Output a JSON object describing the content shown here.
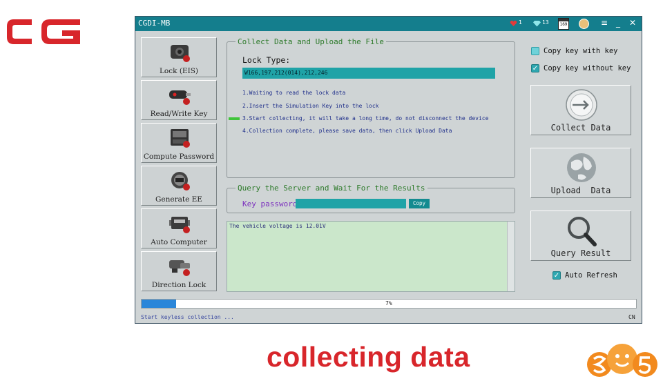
{
  "brand": {
    "caption": "collecting data"
  },
  "window": {
    "title": "CGDI-MB",
    "indicators": {
      "badge_1": "1",
      "badge_2": "13",
      "date": "169"
    },
    "controls": {
      "menu": "≡",
      "minimize": "_",
      "close": "✕"
    }
  },
  "sidebar": {
    "items": [
      {
        "label": "Lock (EIS)",
        "icon": "lock-eis-icon"
      },
      {
        "label": "Read/Write Key",
        "icon": "key-icon"
      },
      {
        "label": "Compute Password",
        "icon": "compute-password-icon"
      },
      {
        "label": "Generate EE",
        "icon": "generate-ee-icon"
      },
      {
        "label": "Auto Computer",
        "icon": "auto-computer-icon"
      },
      {
        "label": "Direction Lock",
        "icon": "direction-lock-icon"
      }
    ]
  },
  "collect_group": {
    "legend": "Collect Data and Upload the File",
    "lock_type_label": "Lock Type:",
    "lock_type_value": "W166,197,212(014),212,246",
    "steps": [
      "1.Waiting to read the lock data",
      "2.Insert the Simulation Key into the lock",
      "3.Start collecting, it will take a long time, do not disconnect the device",
      "4.Collection complete, please save data, then click Upload Data"
    ],
    "current_step": 3
  },
  "query_group": {
    "legend": "Query the Server and Wait For the Results",
    "key_password_label": "Key password",
    "key_password_value": "",
    "copy_label": "Copy"
  },
  "log": {
    "text": "The vehicle voltage is 12.01V"
  },
  "right_panel": {
    "copy_key_with_key": {
      "label": "Copy key with key",
      "checked": false
    },
    "copy_key_without_key": {
      "label": "Copy key without key",
      "checked": true
    },
    "collect_data_label": "Collect Data",
    "upload_data_label": "Upload  Data",
    "query_result_label": "Query Result",
    "auto_refresh": {
      "label": "Auto Refresh",
      "checked": true
    }
  },
  "progress": {
    "percent_text": "7%",
    "value": 0.07
  },
  "status_bar": {
    "message": "Start keyless collection ...",
    "language": "CN"
  },
  "colors": {
    "titlebar": "#147e8d",
    "accent_field": "#1fa3a7",
    "caption": "#d8262b",
    "legend": "#2d7a2a"
  }
}
